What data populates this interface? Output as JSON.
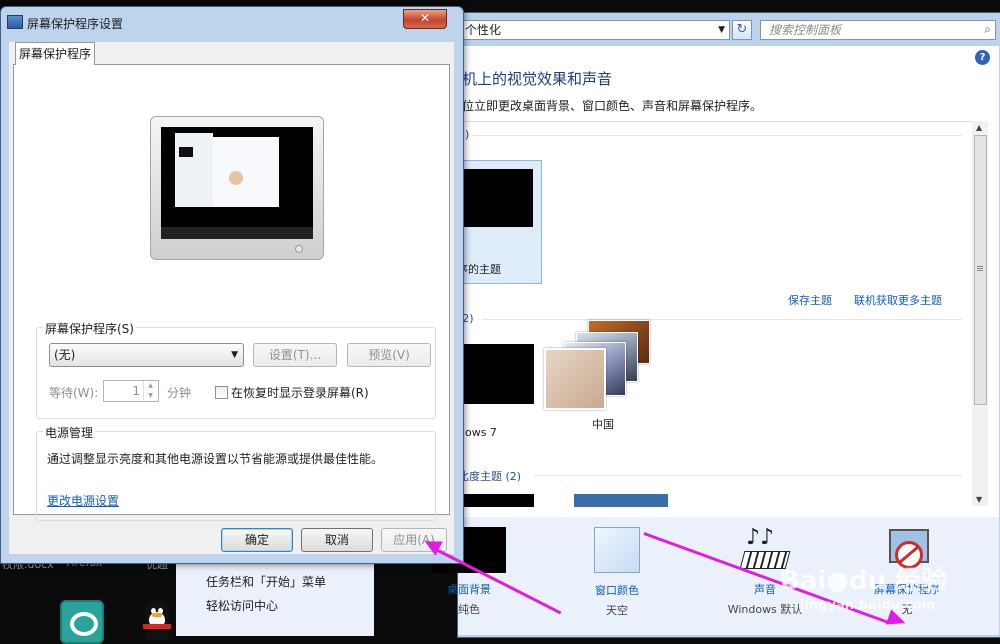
{
  "desktop": {
    "icon_labels": [
      "权限.docx",
      "Firefox",
      "优超"
    ]
  },
  "personalization": {
    "address_fragment": "个性化",
    "search_placeholder": "搜索控制面板",
    "help": "?",
    "heading": "机上的视觉效果和声音",
    "subheading": "位立即更改桌面背景、窗口颜色、声音和屏幕保护程序。",
    "groups": {
      "my_count": "1)",
      "aero_count": "(2)",
      "contrast_label": "比度主题 (2)"
    },
    "themes": {
      "my_theme": "序的主题",
      "win7": "dows 7",
      "china": "中国"
    },
    "links": {
      "save_theme": "保存主题",
      "get_more": "联机获取更多主题"
    },
    "bottom": [
      {
        "label": "桌面背景",
        "value": "纯色"
      },
      {
        "label": "窗口颜色",
        "value": "天空"
      },
      {
        "label": "声音",
        "value": "Windows 默认"
      },
      {
        "label": "屏幕保护程序",
        "value": "无"
      }
    ],
    "see_also": [
      "任务栏和「开始」菜单",
      "轻松访问中心"
    ]
  },
  "dialog": {
    "title": "屏幕保护程序设置",
    "close": "✕",
    "tab": "屏幕保护程序",
    "saver_group": "屏幕保护程序(S)",
    "saver_selected": "(无)",
    "settings_btn": "设置(T)...",
    "preview_btn": "预览(V)",
    "wait_label": "等待(W):",
    "wait_value": "1",
    "wait_unit": "分钟",
    "resume_label": "在恢复时显示登录屏幕(R)",
    "power_group": "电源管理",
    "power_desc": "通过调整显示亮度和其他电源设置以节省能源或提供最佳性能。",
    "power_link": "更改电源设置",
    "ok": "确定",
    "cancel": "取消",
    "apply": "应用(A)"
  },
  "watermark": {
    "brand": "Bai●du 经验",
    "url": "jingyan.baidu.com"
  },
  "colors": {
    "annotation_arrow": "#e21be2",
    "link": "#0f5ebf",
    "title_blue": "#1e3f77"
  }
}
